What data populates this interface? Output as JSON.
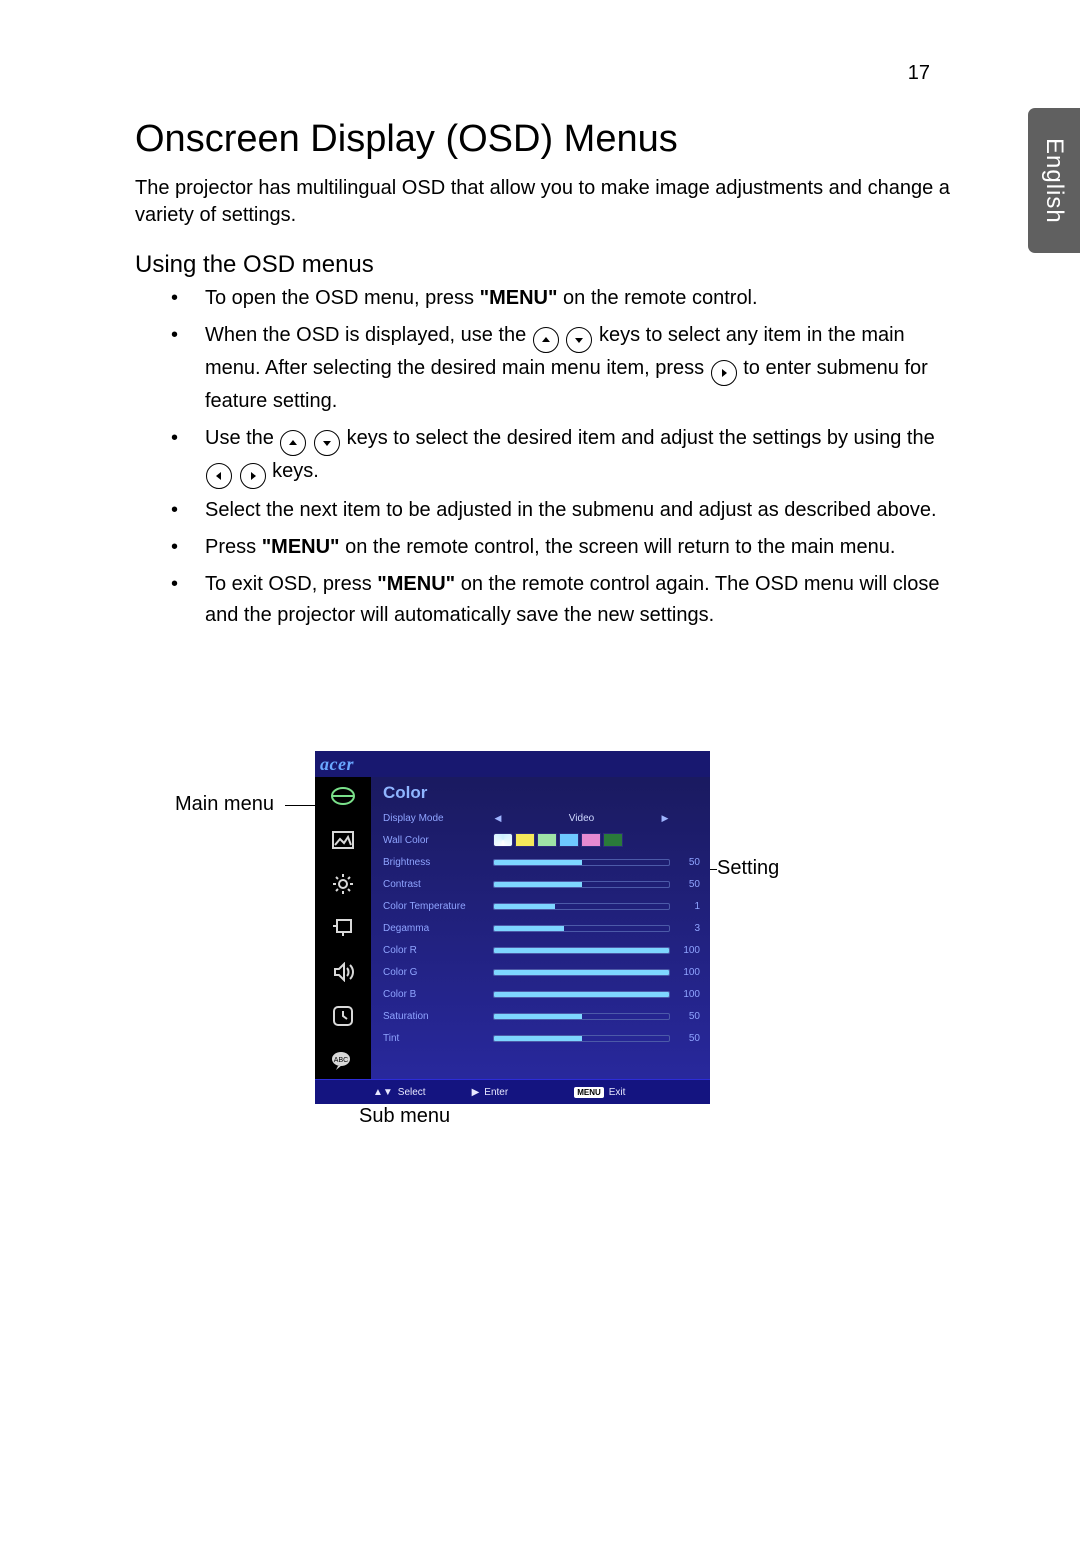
{
  "pageNumber": "17",
  "language": "English",
  "heading": "Onscreen Display (OSD) Menus",
  "intro": "The projector has multilingual OSD that allow you to make image adjustments and change a variety of settings.",
  "subheading": "Using the OSD menus",
  "bulletMenu1": "\"MENU\"",
  "bulletMenu2": "\"MENU\"",
  "bulletMenu3": "\"MENU\"",
  "bullet1a": "To open the OSD menu, press ",
  "bullet1b": " on the remote control.",
  "bullet2a": "When the OSD is displayed, use the ",
  "bullet2b": " keys to select any item in the main menu. After selecting the desired main menu item, press ",
  "bullet2c": " to enter submenu for feature setting.",
  "bullet3a": "Use the ",
  "bullet3b": " keys to select the desired item and adjust the settings by using the ",
  "bullet3c": " keys.",
  "bullet4": "Select the next item to be adjusted in the submenu and adjust as described above.",
  "bullet5a": "Press ",
  "bullet5b": " on the remote control, the screen will return to the main menu.",
  "bullet6a": "To exit OSD, press ",
  "bullet6b": " on the remote control again. The OSD menu will close and the projector will automatically save the new settings.",
  "callouts": {
    "mainMenu": "Main menu",
    "subMenu": "Sub menu",
    "setting": "Setting"
  },
  "osd": {
    "brand": "acer",
    "title": "Color",
    "displayModeLabel": "Display Mode",
    "displayModeValue": "Video",
    "rows": [
      {
        "label": "Wall Color",
        "type": "swatch"
      },
      {
        "label": "Brightness",
        "value": "50",
        "fill": 50
      },
      {
        "label": "Contrast",
        "value": "50",
        "fill": 50
      },
      {
        "label": "Color Temperature",
        "value": "1",
        "fill": 35
      },
      {
        "label": "Degamma",
        "value": "3",
        "fill": 40
      },
      {
        "label": "Color R",
        "value": "100",
        "fill": 100
      },
      {
        "label": "Color G",
        "value": "100",
        "fill": 100
      },
      {
        "label": "Color B",
        "value": "100",
        "fill": 100
      },
      {
        "label": "Saturation",
        "value": "50",
        "fill": 50
      },
      {
        "label": "Tint",
        "value": "50",
        "fill": 50
      }
    ],
    "footer": {
      "select": "Select",
      "enter": "Enter",
      "menu": "MENU",
      "exit": "Exit"
    }
  }
}
